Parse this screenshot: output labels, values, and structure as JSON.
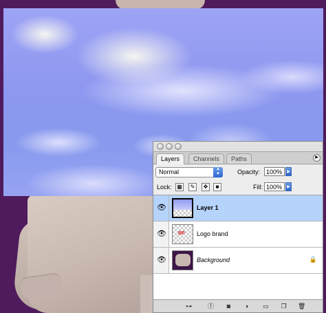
{
  "palette": {
    "tabs": [
      {
        "label": "Layers"
      },
      {
        "label": "Channels"
      },
      {
        "label": "Paths"
      }
    ],
    "blend_mode": "Normal",
    "opacity_label": "Opacity:",
    "opacity_value": "100%",
    "lock_label": "Lock:",
    "fill_label": "Fill:",
    "fill_value": "100%",
    "layers": [
      {
        "name": "Layer 1",
        "selected": true
      },
      {
        "name": "Logo brand",
        "selected": false
      },
      {
        "name": "Background",
        "selected": false,
        "locked": true
      }
    ],
    "thumb_logo_text": "BP"
  },
  "colors": {
    "background": "#4f1b5c",
    "selected_row": "#b5d3fb",
    "aqua_blue": "#2f66d0"
  }
}
